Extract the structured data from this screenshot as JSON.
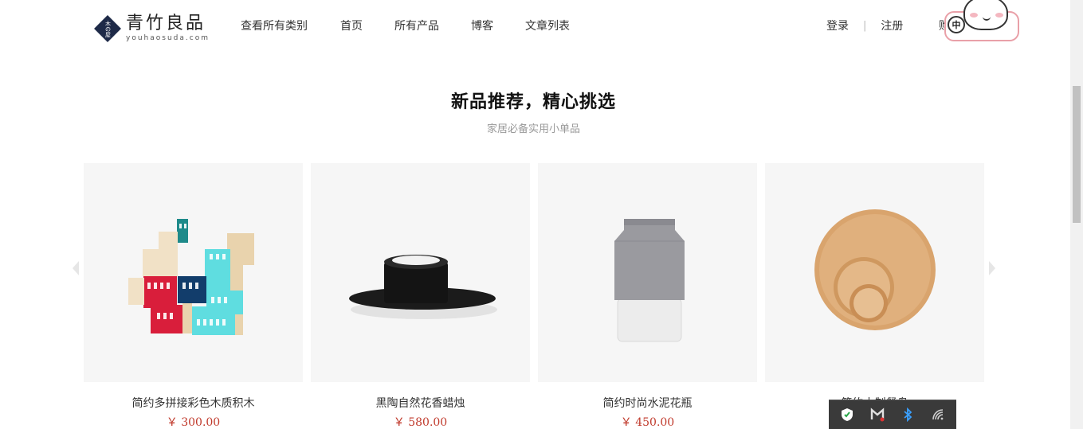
{
  "brand": {
    "name": "青竹良品",
    "domain": "youhaosuda.com",
    "mark_text": "木の屋"
  },
  "nav": {
    "items": [
      {
        "label": "查看所有类别"
      },
      {
        "label": "首页"
      },
      {
        "label": "所有产品"
      },
      {
        "label": "博客"
      },
      {
        "label": "文章列表"
      }
    ]
  },
  "user": {
    "login": "登录",
    "separator": "|",
    "register": "注册",
    "cart": "购"
  },
  "ime": {
    "mode": "中"
  },
  "section": {
    "title": "新品推荐，精心挑选",
    "subtitle": "家居必备实用小单品"
  },
  "products": [
    {
      "name": "简约多拼接彩色木质积木",
      "price": "￥ 300.00"
    },
    {
      "name": "黑陶自然花香蜡烛",
      "price": "￥ 580.00"
    },
    {
      "name": "简约时尚水泥花瓶",
      "price": "￥ 450.00"
    },
    {
      "name": "简约木制餐盘",
      "price": ""
    }
  ],
  "colors": {
    "price": "#c0392b",
    "brand_navy": "#1e2a48",
    "tray_bg": "#3a3a3a"
  },
  "icons": {
    "tray": [
      "security-shield-icon",
      "antivirus-m-icon",
      "bluetooth-icon",
      "wifi-icon"
    ]
  }
}
